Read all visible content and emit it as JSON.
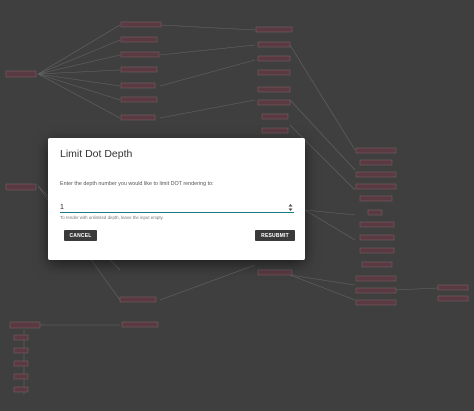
{
  "dialog": {
    "title": "Limit Dot Depth",
    "prompt": "Enter the depth number you would like to limit DOT rendering to:",
    "depth_value": "1",
    "helper": "To render with unlimited depth, leave the input empty.",
    "cancel_label": "CANCEL",
    "resubmit_label": "RESUBMIT"
  },
  "colors": {
    "backdrop": "#3f3f3f",
    "node_fill": "#5a3a42",
    "edge": "#6a6a6a",
    "accent": "#1b7d84",
    "button": "#3a3a3a"
  },
  "icons": {
    "stepper": "number-stepper-icon"
  }
}
